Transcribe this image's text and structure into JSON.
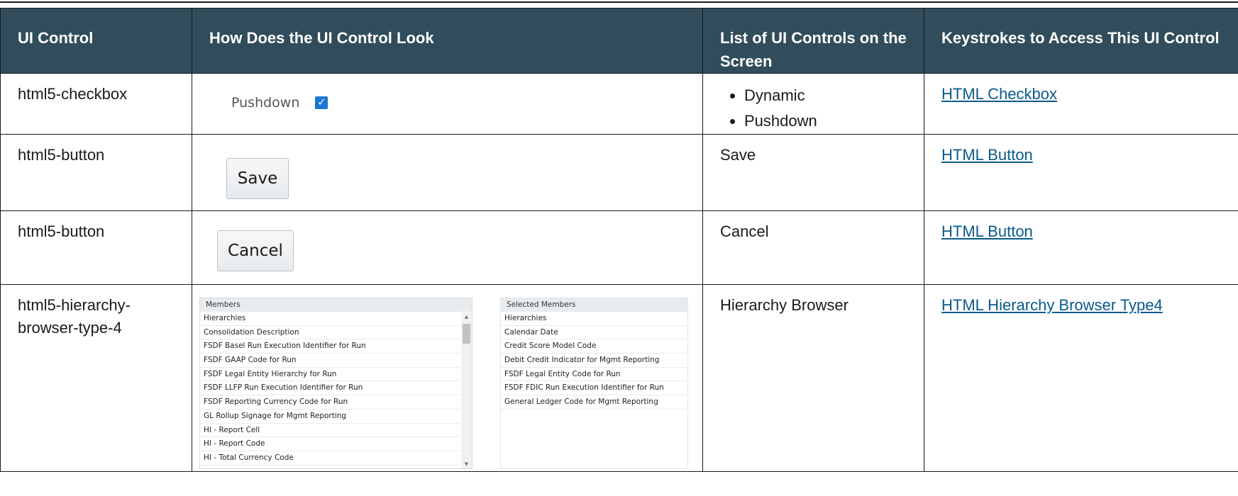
{
  "headers": [
    "UI Control",
    "How Does the UI Control Look",
    "List of UI Controls on the Screen",
    "Keystrokes to Access This UI Control"
  ],
  "rows": [
    {
      "control": "html5-checkbox",
      "look": {
        "label": "Pushdown",
        "checked": true
      },
      "list": [
        "Dynamic",
        "Pushdown"
      ],
      "link": "HTML Checkbox"
    },
    {
      "control": "html5-button",
      "look": {
        "button_label": "Save"
      },
      "list_text": "Save",
      "link": "HTML Button"
    },
    {
      "control": "html5-button",
      "look": {
        "button_label": "Cancel"
      },
      "list_text": "Cancel",
      "link": "HTML Button"
    },
    {
      "control": "html5-hierarchy-browser-type-4",
      "look": {
        "members_title": "Members",
        "members": [
          "Hierarchies",
          "Consolidation Description",
          "FSDF Basel Run Execution Identifier for Run",
          "FSDF GAAP Code for Run",
          "FSDF Legal Entity Hierarchy for Run",
          "FSDF LLFP Run Execution Identifier for Run",
          "FSDF Reporting Currency Code for Run",
          "GL Rollup Signage for Mgmt Reporting",
          "HI - Report Cell",
          "HI - Report Code",
          "HI - Total Currency Code"
        ],
        "selected_title": "Selected Members",
        "selected": [
          "Hierarchies",
          "Calendar Date",
          "Credit Score Model Code",
          "Debit Credit Indicator for Mgmt Reporting",
          "FSDF Legal Entity Code for Run",
          "FSDF FDIC Run Execution Identifier for Run",
          "General Ledger Code for Mgmt Reporting"
        ]
      },
      "list_text": "Hierarchy Browser",
      "link": "HTML Hierarchy Browser Type4"
    }
  ],
  "colors": {
    "header_bg": "#314d5b",
    "link": "#0a5a8c",
    "checkbox": "#1c76d2"
  }
}
